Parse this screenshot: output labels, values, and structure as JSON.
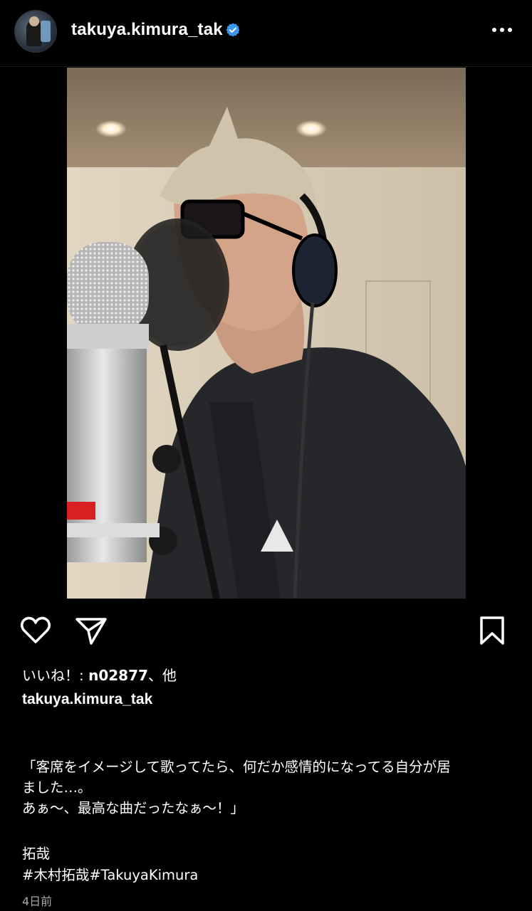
{
  "post": {
    "username": "takuya.kimura_tak",
    "verified": true,
    "photo_alt": "Man singing into studio microphone with headphones",
    "likes_prefix": "いいね！: ",
    "likes_user": "n02877",
    "likes_suffix": "、他",
    "caption_user": "takuya.kimura_tak",
    "caption_text": "「客席をイメージして歌ってたら、何だか感情的になってる自分が居\nました…。\nあぁ〜、最高な曲だったなぁ〜！」",
    "signature": "拓哉",
    "hashtags": "#木村拓哉#TakuyaKimura",
    "timestamp": "4日前"
  },
  "icons": {
    "avatar": "avatar-icon",
    "verified": "verified-badge-icon",
    "more": "more-dots-icon",
    "like": "heart-icon",
    "share": "share-send-icon",
    "save": "bookmark-icon"
  },
  "colors": {
    "background": "#000000",
    "verified_blue": "#3897f0",
    "text_secondary": "#a8a8a8"
  }
}
